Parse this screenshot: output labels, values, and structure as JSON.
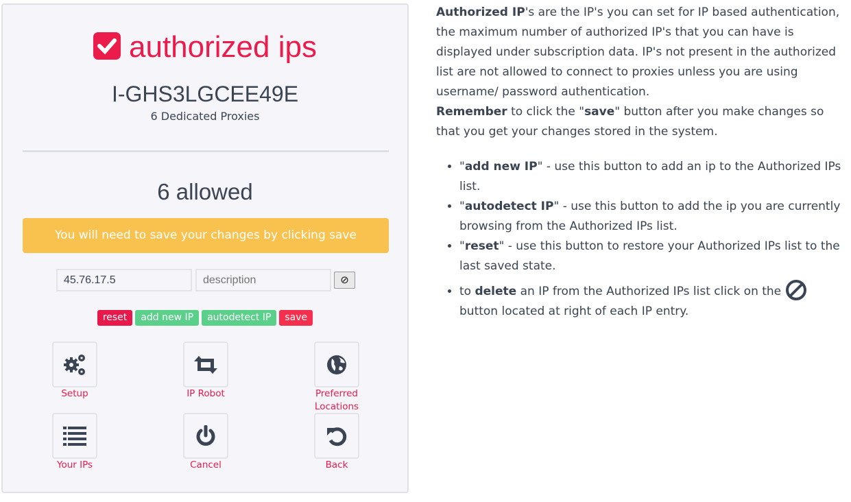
{
  "panel": {
    "title": "authorized ips",
    "account_id": "I-GHS3LGCEE49E",
    "proxies": "6 Dedicated Proxies",
    "allowed": "6 allowed",
    "warning": "You will need to save your changes by clicking save",
    "ip_value": "45.76.17.5",
    "description_placeholder": "description",
    "buttons": {
      "reset": "reset",
      "add": "add new IP",
      "autodetect": "autodetect IP",
      "save": "save"
    },
    "tiles": [
      {
        "label": "Setup",
        "icon": "gears-icon"
      },
      {
        "label": "IP Robot",
        "icon": "retweet-icon"
      },
      {
        "label": "Preferred Locations",
        "icon": "globe-icon"
      },
      {
        "label": "Your IPs",
        "icon": "list-icon"
      },
      {
        "label": "Cancel",
        "icon": "power-icon"
      },
      {
        "label": "Back",
        "icon": "undo-icon"
      }
    ]
  },
  "colors": {
    "accent": "#eb1b4c",
    "green": "#5ad08a",
    "warning": "#f9c24f",
    "text": "#3a4452"
  },
  "help": {
    "p1_bold": "Authorized IP",
    "p1": "'s are the IP's you can set for IP based authentication, the maximum number of authorized IP's that you can have is displayed under subscription data. IP's not present in the authorized list are not allowed to connect to proxies unless you are using username/ password authentication.",
    "p2_bold": "Remember",
    "p2a": " to click the \"",
    "p2_save": "save",
    "p2b": "\" button after you make changes so that you get your changes stored in the system.",
    "items": [
      {
        "bold": "add new IP",
        "text": "\" - use this button to add an ip to the Authorized IPs list."
      },
      {
        "bold": "autodetect IP",
        "text": "\" - use this button to add the ip you are currently browsing from the Authorized IPs list."
      },
      {
        "bold": "reset",
        "text": "\" - use this button to restore your Authorized IPs list to the last saved state."
      }
    ],
    "last_pre": "to ",
    "last_bold": "delete",
    "last_mid": " an IP from the Authorized IPs list click on the ",
    "last_post": " button located at right of each IP entry."
  }
}
